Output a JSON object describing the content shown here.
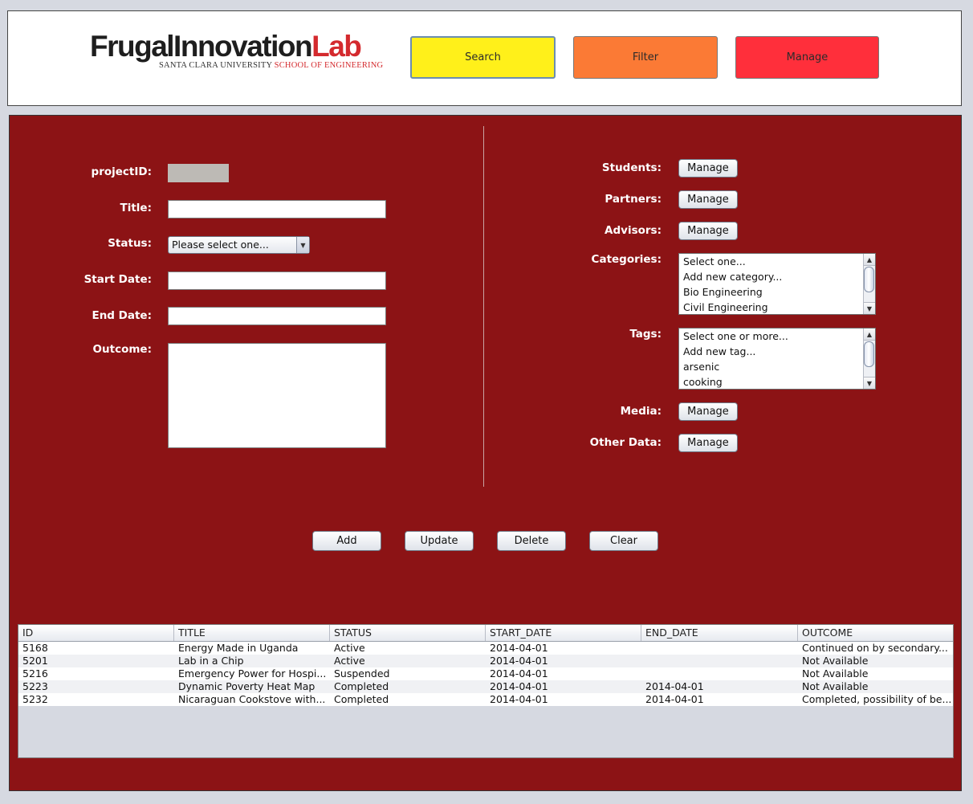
{
  "logo": {
    "main_text": "FrugalInnovation",
    "accent_text": "Lab",
    "university": "SANTA CLARA UNIVERSITY",
    "school": "SCHOOL OF ENGINEERING"
  },
  "nav": {
    "search_label": "Search",
    "filter_label": "Filter",
    "manage_label": "Manage",
    "search_color": "#fff01a",
    "filter_color": "#fb7a35",
    "manage_color": "#ff2f3b"
  },
  "form": {
    "project_id_label": "projectID:",
    "title_label": "Title:",
    "status_label": "Status:",
    "status_value": "Please select one...",
    "start_date_label": "Start Date:",
    "end_date_label": "End Date:",
    "outcome_label": "Outcome:"
  },
  "relations": {
    "students_label": "Students:",
    "partners_label": "Partners:",
    "advisors_label": "Advisors:",
    "categories_label": "Categories:",
    "tags_label": "Tags:",
    "media_label": "Media:",
    "other_data_label": "Other Data:",
    "manage_button": "Manage",
    "categories": [
      "Select one...",
      "Add new category...",
      "Bio Engineering",
      "Civil Engineering"
    ],
    "tags": [
      "Select one or more...",
      "Add new tag...",
      "arsenic",
      "cooking"
    ]
  },
  "actions": {
    "add": "Add",
    "update": "Update",
    "delete": "Delete",
    "clear": "Clear"
  },
  "table": {
    "columns": [
      "ID",
      "TITLE",
      "STATUS",
      "START_DATE",
      "END_DATE",
      "OUTCOME"
    ],
    "rows": [
      [
        "5168",
        "Energy Made in Uganda",
        "Active",
        "2014-04-01",
        "",
        "Continued on by secondary..."
      ],
      [
        "5201",
        "Lab in a Chip",
        "Active",
        "2014-04-01",
        "",
        "Not Available"
      ],
      [
        "5216",
        "Emergency Power for Hospi...",
        "Suspended",
        "2014-04-01",
        "",
        "Not Available"
      ],
      [
        "5223",
        "Dynamic Poverty Heat Map",
        "Completed",
        "2014-04-01",
        "2014-04-01",
        "Not Available"
      ],
      [
        "5232",
        "Nicaraguan Cookstove with...",
        "Completed",
        "2014-04-01",
        "2014-04-01",
        "Completed, possibility of be..."
      ]
    ]
  },
  "colors": {
    "panel_background": "#8c1315",
    "window_background": "#d6d9e1"
  }
}
